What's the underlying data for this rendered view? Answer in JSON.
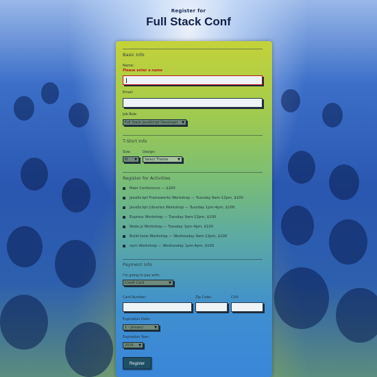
{
  "header": {
    "pre_title": "Register for",
    "title": "Full Stack Conf"
  },
  "basic_info": {
    "section_title": "Basic Info",
    "name_label": "Name:",
    "name_error": "Please enter a name",
    "name_value": "",
    "email_label": "Email:",
    "email_value": "",
    "job_role_label": "Job Role",
    "job_role_selected": "Full Stack JavaScript Developer"
  },
  "tshirt": {
    "section_title": "T-Shirt Info",
    "size_label": "Size:",
    "size_selected": "M",
    "design_label": "Design:",
    "design_selected": "Select Theme"
  },
  "activities": {
    "section_title": "Register for Activities",
    "items": [
      "Main Conference — $200",
      "JavaScript Frameworks Workshop — Tuesday 9am-12pm, $100",
      "JavaScript Libraries Workshop — Tuesday 1pm-4pm, $100",
      "Express Workshop — Tuesday 9am-12pm, $100",
      "Node.js Workshop — Tuesday 1pm-4pm, $100",
      "Build tools Workshop — Wednesday 9am-12pm, $100",
      "npm Workshop — Wednesday 1pm-4pm, $100"
    ]
  },
  "payment": {
    "section_title": "Payment Info",
    "pay_with_label": "I'm going to pay with:",
    "pay_with_selected": "Credit Card",
    "card_number_label": "Card Number:",
    "zip_label": "Zip Code:",
    "cvv_label": "CVV:",
    "exp_date_label": "Expiration Date:",
    "exp_date_selected": "1 - January",
    "exp_year_label": "Expiration Year:",
    "exp_year_selected": "2016"
  },
  "register_button": "Register",
  "icons": {
    "select_arrow": "caret-down-icon",
    "checkbox": "checkbox-icon"
  }
}
